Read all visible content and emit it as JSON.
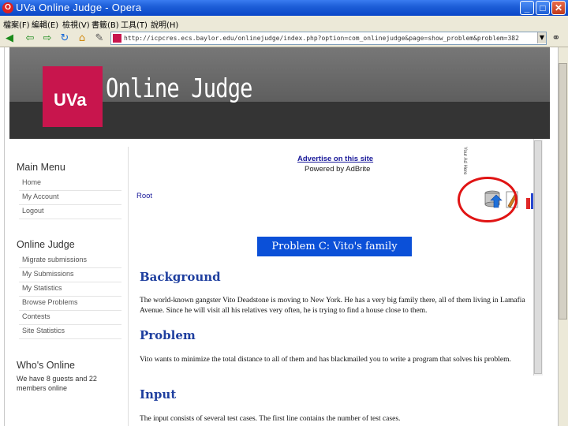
{
  "window": {
    "title": "UVa Online Judge - Opera"
  },
  "menubar": {
    "items": [
      "檔案(F)",
      "編輯(E)",
      "檢視(V)",
      "書籤(B)",
      "工具(T)",
      "說明(H)"
    ]
  },
  "address_bar": {
    "url": "http://icpcres.ecs.baylor.edu/onlinejudge/index.php?option=com_onlinejudge&page=show_problem&problem=382"
  },
  "header": {
    "logo_text": "UVa",
    "site_title": "Online Judge"
  },
  "sidebar": {
    "main_menu_heading": "Main Menu",
    "main_menu": [
      "Home",
      "My Account",
      "Logout"
    ],
    "online_judge_heading": "Online Judge",
    "online_judge": [
      "Migrate submissions",
      "My Submissions",
      "My Statistics",
      "Browse Problems",
      "Contests",
      "Site Statistics"
    ],
    "whos_online_heading": "Who's Online",
    "whos_online_text": "We have 8 guests and 22 members online"
  },
  "ad": {
    "link": "Advertise on this site",
    "powered": "Powered by AdBrite",
    "vertical": "Your Ad Here"
  },
  "breadcrumb": {
    "root": "Root"
  },
  "problem": {
    "title": "Problem C: Vito's family",
    "sections": [
      {
        "heading": "Background",
        "text": "The world-known gangster Vito Deadstone is moving to New York. He has a very big family there, all of them living in Lamafia Avenue. Since he will visit all his relatives very often, he is trying to find a house close to them."
      },
      {
        "heading": "Problem",
        "text": "Vito wants to minimize the total distance to all of them and has blackmailed you to write a program that solves his problem."
      },
      {
        "heading": "Input",
        "text": "The input consists of several test cases. The first line contains the number of test cases."
      }
    ]
  },
  "colors": {
    "titlebar": "#0a46c8",
    "brand": "#c8154d",
    "problem_title_bg": "#0b50d8",
    "section_heading": "#1f3f9f",
    "annotation": "#e01414"
  }
}
